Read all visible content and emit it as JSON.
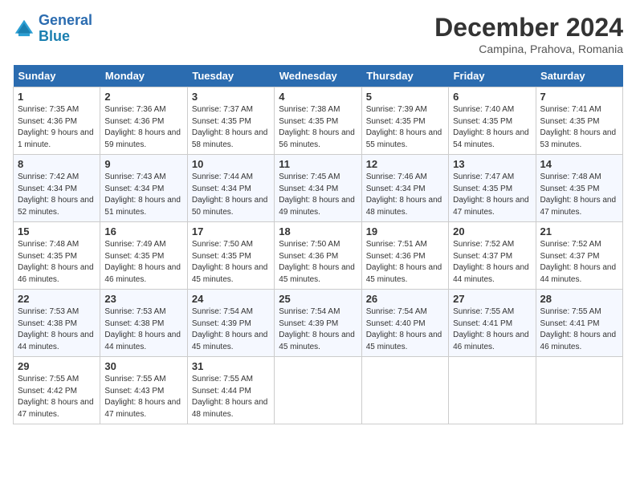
{
  "header": {
    "logo_line1": "General",
    "logo_line2": "Blue",
    "month": "December 2024",
    "location": "Campina, Prahova, Romania"
  },
  "days_of_week": [
    "Sunday",
    "Monday",
    "Tuesday",
    "Wednesday",
    "Thursday",
    "Friday",
    "Saturday"
  ],
  "weeks": [
    [
      {
        "day": "1",
        "sunrise": "7:35 AM",
        "sunset": "4:36 PM",
        "daylight": "9 hours and 1 minute."
      },
      {
        "day": "2",
        "sunrise": "7:36 AM",
        "sunset": "4:36 PM",
        "daylight": "8 hours and 59 minutes."
      },
      {
        "day": "3",
        "sunrise": "7:37 AM",
        "sunset": "4:35 PM",
        "daylight": "8 hours and 58 minutes."
      },
      {
        "day": "4",
        "sunrise": "7:38 AM",
        "sunset": "4:35 PM",
        "daylight": "8 hours and 56 minutes."
      },
      {
        "day": "5",
        "sunrise": "7:39 AM",
        "sunset": "4:35 PM",
        "daylight": "8 hours and 55 minutes."
      },
      {
        "day": "6",
        "sunrise": "7:40 AM",
        "sunset": "4:35 PM",
        "daylight": "8 hours and 54 minutes."
      },
      {
        "day": "7",
        "sunrise": "7:41 AM",
        "sunset": "4:35 PM",
        "daylight": "8 hours and 53 minutes."
      }
    ],
    [
      {
        "day": "8",
        "sunrise": "7:42 AM",
        "sunset": "4:34 PM",
        "daylight": "8 hours and 52 minutes."
      },
      {
        "day": "9",
        "sunrise": "7:43 AM",
        "sunset": "4:34 PM",
        "daylight": "8 hours and 51 minutes."
      },
      {
        "day": "10",
        "sunrise": "7:44 AM",
        "sunset": "4:34 PM",
        "daylight": "8 hours and 50 minutes."
      },
      {
        "day": "11",
        "sunrise": "7:45 AM",
        "sunset": "4:34 PM",
        "daylight": "8 hours and 49 minutes."
      },
      {
        "day": "12",
        "sunrise": "7:46 AM",
        "sunset": "4:34 PM",
        "daylight": "8 hours and 48 minutes."
      },
      {
        "day": "13",
        "sunrise": "7:47 AM",
        "sunset": "4:35 PM",
        "daylight": "8 hours and 47 minutes."
      },
      {
        "day": "14",
        "sunrise": "7:48 AM",
        "sunset": "4:35 PM",
        "daylight": "8 hours and 47 minutes."
      }
    ],
    [
      {
        "day": "15",
        "sunrise": "7:48 AM",
        "sunset": "4:35 PM",
        "daylight": "8 hours and 46 minutes."
      },
      {
        "day": "16",
        "sunrise": "7:49 AM",
        "sunset": "4:35 PM",
        "daylight": "8 hours and 46 minutes."
      },
      {
        "day": "17",
        "sunrise": "7:50 AM",
        "sunset": "4:35 PM",
        "daylight": "8 hours and 45 minutes."
      },
      {
        "day": "18",
        "sunrise": "7:50 AM",
        "sunset": "4:36 PM",
        "daylight": "8 hours and 45 minutes."
      },
      {
        "day": "19",
        "sunrise": "7:51 AM",
        "sunset": "4:36 PM",
        "daylight": "8 hours and 45 minutes."
      },
      {
        "day": "20",
        "sunrise": "7:52 AM",
        "sunset": "4:37 PM",
        "daylight": "8 hours and 44 minutes."
      },
      {
        "day": "21",
        "sunrise": "7:52 AM",
        "sunset": "4:37 PM",
        "daylight": "8 hours and 44 minutes."
      }
    ],
    [
      {
        "day": "22",
        "sunrise": "7:53 AM",
        "sunset": "4:38 PM",
        "daylight": "8 hours and 44 minutes."
      },
      {
        "day": "23",
        "sunrise": "7:53 AM",
        "sunset": "4:38 PM",
        "daylight": "8 hours and 44 minutes."
      },
      {
        "day": "24",
        "sunrise": "7:54 AM",
        "sunset": "4:39 PM",
        "daylight": "8 hours and 45 minutes."
      },
      {
        "day": "25",
        "sunrise": "7:54 AM",
        "sunset": "4:39 PM",
        "daylight": "8 hours and 45 minutes."
      },
      {
        "day": "26",
        "sunrise": "7:54 AM",
        "sunset": "4:40 PM",
        "daylight": "8 hours and 45 minutes."
      },
      {
        "day": "27",
        "sunrise": "7:55 AM",
        "sunset": "4:41 PM",
        "daylight": "8 hours and 46 minutes."
      },
      {
        "day": "28",
        "sunrise": "7:55 AM",
        "sunset": "4:41 PM",
        "daylight": "8 hours and 46 minutes."
      }
    ],
    [
      {
        "day": "29",
        "sunrise": "7:55 AM",
        "sunset": "4:42 PM",
        "daylight": "8 hours and 47 minutes."
      },
      {
        "day": "30",
        "sunrise": "7:55 AM",
        "sunset": "4:43 PM",
        "daylight": "8 hours and 47 minutes."
      },
      {
        "day": "31",
        "sunrise": "7:55 AM",
        "sunset": "4:44 PM",
        "daylight": "8 hours and 48 minutes."
      },
      null,
      null,
      null,
      null
    ]
  ],
  "labels": {
    "sunrise_prefix": "Sunrise: ",
    "sunset_prefix": "Sunset: ",
    "daylight_prefix": "Daylight: "
  }
}
